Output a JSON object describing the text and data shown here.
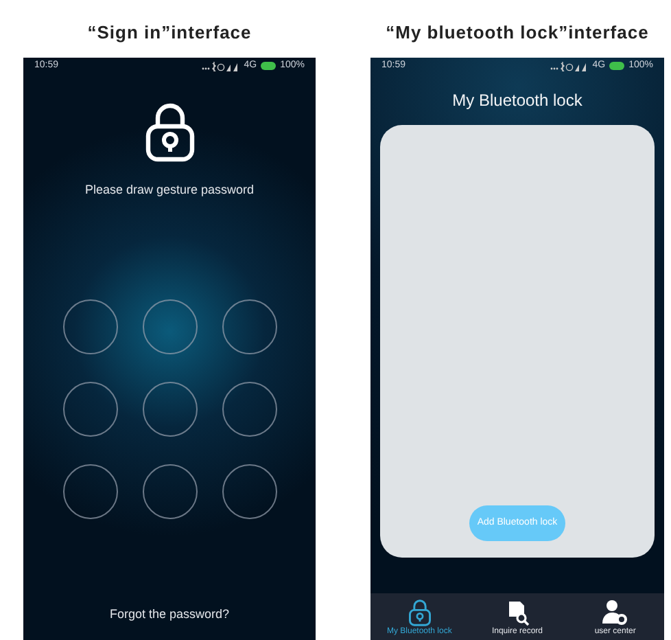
{
  "panels": [
    {
      "kind": "signin",
      "caption": "“Sign in”interface",
      "status": {
        "time": "10:59",
        "network": "4G",
        "battery": "100%"
      },
      "prompt": "Please draw gesture password",
      "forgot": "Forgot the password?"
    },
    {
      "kind": "locks",
      "caption": "“My bluetooth lock”interface",
      "status": {
        "time": "10:59",
        "network": "4G",
        "battery": "100%"
      },
      "title": "My Bluetooth lock",
      "add_button": "Add Bluetooth lock",
      "tabs": [
        {
          "label": "My Bluetooth lock",
          "kind": "lock",
          "selected": true
        },
        {
          "label": "Inquire record",
          "kind": "record",
          "selected": false
        },
        {
          "label": "user center",
          "kind": "user",
          "selected": false
        }
      ]
    }
  ]
}
